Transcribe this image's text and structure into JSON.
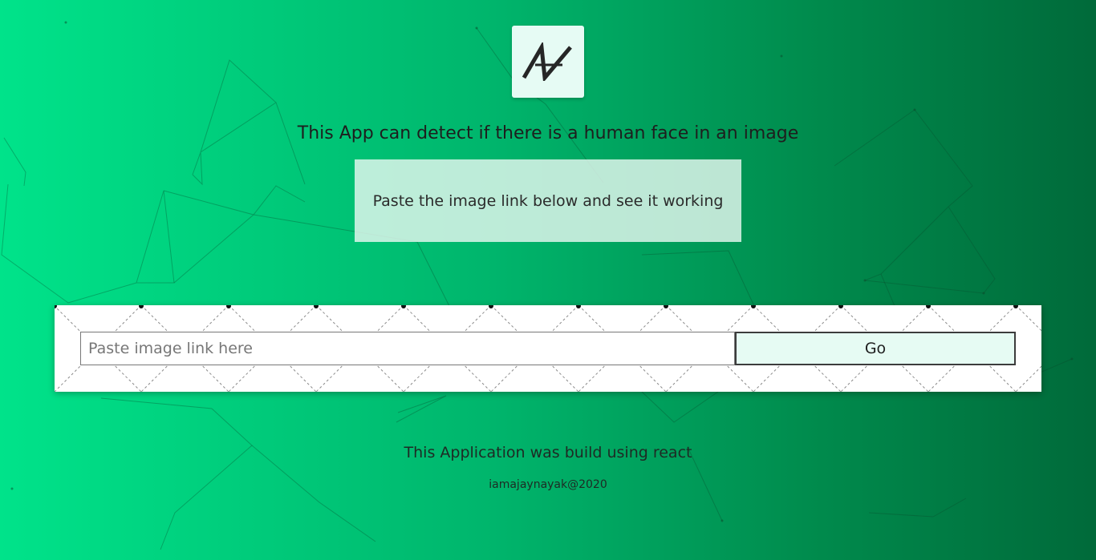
{
  "app": {
    "logo_icon": "brand-logo-icon",
    "headline": "This App can detect if there is a human face in an image",
    "instruction": "Paste the image link below and see it working"
  },
  "form": {
    "input_placeholder": "Paste image link here",
    "input_value": "",
    "submit_label": "Go"
  },
  "footer": {
    "credit": "This Application was build using react",
    "copyright": "iamajaynayak@2020"
  },
  "colors": {
    "background_start": "#00e38a",
    "background_end": "#006a3a",
    "card_background": "#e6f8f0",
    "button_background": "#e6fbf3"
  }
}
